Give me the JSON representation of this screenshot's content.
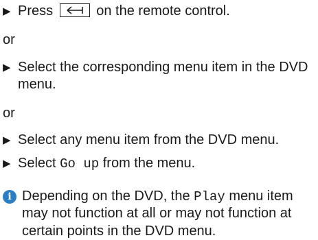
{
  "steps": {
    "s1": {
      "before": "Press",
      "after": "on the remote control."
    },
    "or1": "or",
    "s2": {
      "text": "Select the corresponding menu item in the DVD menu."
    },
    "or2": "or",
    "s3": {
      "text": "Select any menu item from the DVD menu."
    },
    "s4": {
      "before": "Select",
      "mono": "Go up",
      "after": "from the menu."
    }
  },
  "note": {
    "icon": "info-icon",
    "before": "Depending on the DVD, the",
    "mono": "Play",
    "after": "menu item may not function at all or may not function at certain points in the DVD menu."
  },
  "key_icon": "back-arrow-key-icon"
}
